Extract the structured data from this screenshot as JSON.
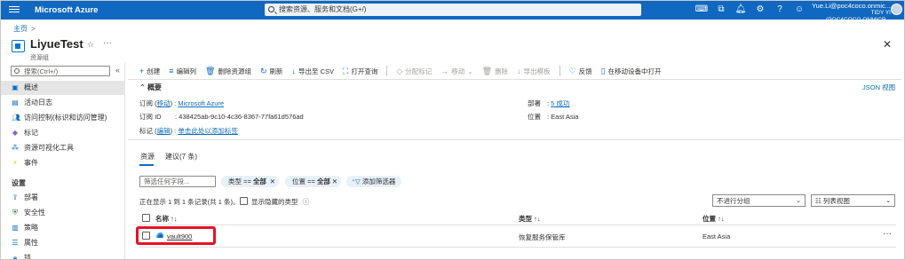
{
  "topbar": {
    "brand": "Microsoft Azure",
    "search_placeholder": "搜索资源、服务和文档(G+/)",
    "account_email": "Yue.Li@poc4coco.onmic...",
    "account_tenant": "TIDY YI (POC4COCO.ONMICR..."
  },
  "breadcrumb": {
    "home": "主页",
    "separator": ">"
  },
  "header": {
    "title": "LiyueTest",
    "subtitle": "资源组",
    "pin": "☆",
    "more": "···",
    "close": "✕"
  },
  "leftnav": {
    "search_placeholder": "搜索(Ctrl+/)",
    "collapse": "«",
    "items": [
      {
        "label": "概述",
        "icon": "overview-icon"
      },
      {
        "label": "活动日志",
        "icon": "activity-log-icon"
      },
      {
        "label": "访问控制(标识和访问管理)",
        "icon": "access-control-icon"
      },
      {
        "label": "标记",
        "icon": "tag-icon"
      },
      {
        "label": "资源可视化工具",
        "icon": "visualizer-icon"
      },
      {
        "label": "事件",
        "icon": "events-icon"
      }
    ],
    "section": "设置",
    "settings_items": [
      {
        "label": "部署",
        "icon": "deployments-icon"
      },
      {
        "label": "安全性",
        "icon": "security-icon"
      },
      {
        "label": "策略",
        "icon": "policies-icon"
      },
      {
        "label": "属性",
        "icon": "properties-icon"
      },
      {
        "label": "锁",
        "icon": "lock-icon"
      }
    ]
  },
  "toolbar": [
    {
      "label": "创建",
      "icon": "+",
      "enabled": true
    },
    {
      "label": "编辑列",
      "icon": "≡",
      "enabled": true
    },
    {
      "label": "删除资源组",
      "icon": "🗑",
      "enabled": true
    },
    {
      "label": "刷新",
      "icon": "↻",
      "enabled": true
    },
    {
      "label": "导出至 CSV",
      "icon": "↓",
      "enabled": true
    },
    {
      "label": "打开查询",
      "icon": "⛶",
      "enabled": true
    },
    {
      "label": "分配标记",
      "icon": "◇",
      "enabled": false
    },
    {
      "label": "移动",
      "icon": "→",
      "enabled": false,
      "dropdown": true
    },
    {
      "label": "删除",
      "icon": "🗑",
      "enabled": false
    },
    {
      "label": "导出模板",
      "icon": "↓",
      "enabled": false
    },
    {
      "label": "反馈",
      "icon": "♡",
      "enabled": true
    },
    {
      "label": "在移动设备中打开",
      "icon": "▯",
      "enabled": true
    }
  ],
  "essentials": {
    "heading": "概要",
    "json_view": "JSON 视图",
    "subscription_label": "订阅 (",
    "subscription_move": "移动",
    "subscription_sep": ") :",
    "subscription_value": "Microsoft Azure",
    "subscription_id_label": "订阅 ID",
    "subscription_id_value": "438425ab-9c10-4c36-8367-77fa61d576ad",
    "tags_label": "标记 (",
    "tags_edit": "编辑",
    "tags_sep": ") :",
    "tags_value": "单击此处以添加标签",
    "deployments_label": "部署",
    "deployments_value": "5 成功",
    "location_label": "位置",
    "location_value": "East Asia"
  },
  "tabs": [
    {
      "label": "资源"
    },
    {
      "label": "建议(7 条)"
    }
  ],
  "filters": {
    "search_placeholder": "筛选任何字段...",
    "type_filter": "类型 == ",
    "type_value": "全部",
    "location_filter": "位置 == ",
    "location_value": "全部",
    "add_filter": "添加筛选器",
    "showing": "正在显示 1 到 1 条记录(共 1 条)。",
    "show_hidden": "显示隐藏的类型",
    "grouping": "不进行分组",
    "view": "列表视图"
  },
  "table": {
    "columns": [
      "名称 ↑↓",
      "类型 ↑↓",
      "位置 ↑↓"
    ],
    "rows": [
      {
        "name": "vault900",
        "type": "恢复服务保管库",
        "location": "East Asia"
      }
    ]
  }
}
